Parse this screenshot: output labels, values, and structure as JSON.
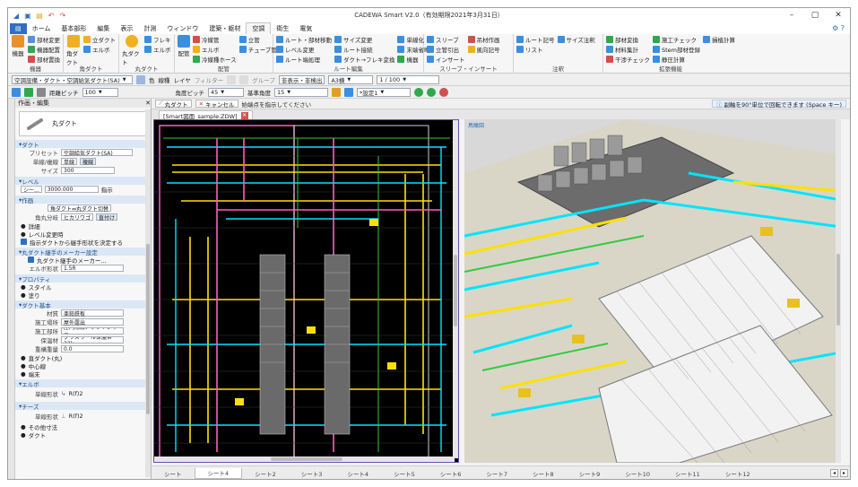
{
  "window": {
    "title": "CADEWA Smart V2.0（有効期限2021年3月31日）",
    "minimize": "–",
    "maximize": "▢",
    "close": "✕"
  },
  "ribbon_tabs": [
    "ホーム",
    "基本部形",
    "編集",
    "表示",
    "計測",
    "ウィンドウ",
    "建築・躯材",
    "空調",
    "衛生",
    "電気"
  ],
  "ribbon_active_tab": "空調",
  "ribbon": {
    "groups": [
      {
        "label": "機器",
        "items": [
          "機器",
          "部材変更",
          "部材置換",
          "機器配置",
          "角度変更"
        ]
      },
      {
        "label": "角ダクト",
        "items": [
          "立ダクト",
          "エルボ",
          "角ダクト"
        ]
      },
      {
        "label": "丸ダクト",
        "items": [
          "フレキ",
          "エルボ",
          "丸ダクト"
        ]
      },
      {
        "label": "配管",
        "items": [
          "冷媒管",
          "エルボ",
          "冷媒種ホース",
          "立管",
          "チューブ管",
          "配管"
        ]
      },
      {
        "label": "ルート編集",
        "items": [
          "ルート・部材移動",
          "サイズ変更",
          "レベル変更",
          "ルート接続",
          "ルート端処理",
          "ダクト→フレキ変換",
          "単線化",
          "末端省略",
          "機器"
        ]
      },
      {
        "label": "スリーブ・インサート",
        "items": [
          "スリーブ",
          "立管引出",
          "インサート",
          "吊材作画",
          "風向記号"
        ]
      },
      {
        "label": "注釈",
        "items": [
          "ルート記号",
          "サイズ注釈",
          "リスト"
        ]
      },
      {
        "label": "拡張機能",
        "items": [
          "部材変換",
          "材料集計",
          "干渉チェック",
          "施工チェック",
          "Stem部材登録",
          "静圧計算",
          "損植計算"
        ]
      }
    ]
  },
  "toolbar1": {
    "system": "空調設備・ダクト・空調給気ダクト(SA)",
    "color_label": "色",
    "line_style": "線種",
    "layer_label": "レイヤ",
    "filter_label": "フィルター",
    "group_label": "グループ",
    "hide_label": "非表示・非検出",
    "paper_size": "A3横",
    "scale": "1 / 100"
  },
  "toolbar2": {
    "grid_pitch_label": "距離ピッチ",
    "grid_pitch": "100",
    "angle_pitch_label": "角度ピッチ",
    "angle_pitch": "45",
    "base_angle_label": "基準角度",
    "base_angle": "15",
    "setting": "*設定1"
  },
  "panel": {
    "title": "作画・編集",
    "part_name": "丸ダクト",
    "sections": {
      "duct": "ダクト",
      "level": "レベル",
      "drawing": "作画",
      "property": "プロパティ",
      "duct_basic": "ダクト基本",
      "elbow": "エルボ",
      "cheese": "チーズ"
    },
    "preset_label": "プリセット",
    "preset_value": "空調給気ダクト(SA)",
    "line_label": "単線/複線",
    "line_single": "単線",
    "line_double": "複線",
    "size_label": "サイズ",
    "size_value": "300",
    "level_value": "3000.000",
    "level_ref": "シー...",
    "level_show": "指示",
    "switch_label": "角ダクト⇔丸ダクト切替",
    "branch_label": "角丸分岐",
    "branch_opt1": "ヒカリワゴ",
    "branch_opt2": "直付け",
    "bullets_top": [
      "詳細",
      "レベル変更時"
    ],
    "check1": "指示ダクトから継手形状を決定する",
    "maker_section": "丸ダクト継手のメーカー設定",
    "check2": "丸ダクト継手のメーカー...",
    "elbow_type_label": "エルボ形状",
    "elbow_type": "1.5R",
    "bullets_prop": [
      "スタイル",
      "塗り"
    ],
    "props": [
      {
        "label": "材質",
        "value": "亜鉛鉄板"
      },
      {
        "label": "施工場所",
        "value": "屋外露出"
      },
      {
        "label": "施工部所",
        "value": "屋内隠蔽、ダクトシャフ..."
      },
      {
        "label": "保温材",
        "value": "グラスウール保温帯32k"
      },
      {
        "label": "重構重量",
        "value": "0.0"
      }
    ],
    "bullets_mid": [
      "直ダクト(丸)",
      "中心線",
      "端末"
    ],
    "elbow_shape_label": "単線形状",
    "elbow_value": "R(f)2",
    "cheese_value": "R(f)2",
    "bullets_end": [
      "その他寸法",
      "ダクト"
    ]
  },
  "cmdbar": {
    "mode": "丸ダクト",
    "cancel": "キャンセル",
    "prompt": "始端点を指示してください",
    "hint": "副軸を90°単位で回転できます (Space キー)"
  },
  "doc_tab": "[Smart図面_sample.ZDW]",
  "view3d_label": "鳥瞰図",
  "sheets": [
    "シート",
    "シート4",
    "シート2",
    "シート3",
    "シート4",
    "シート5",
    "シート6",
    "シート7",
    "シート8",
    "シート9",
    "シート10",
    "シート11",
    "シート12"
  ],
  "sheet_active_index": 1,
  "colors": {
    "accent": "#2f6fbf",
    "cad_bg": "#000000",
    "pink": "#ff5fb4",
    "yellow": "#ffe000",
    "cyan": "#00e5ff",
    "green": "#2ecc40"
  }
}
